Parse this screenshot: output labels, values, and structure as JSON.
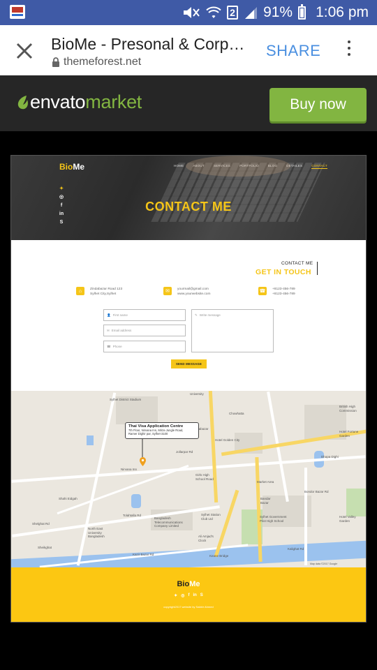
{
  "status_bar": {
    "battery": "91%",
    "time": "1:06 pm",
    "sim_slot": "2"
  },
  "browser": {
    "page_title": "BioMe - Presonal & Corporate",
    "url": "themeforest.net",
    "share_label": "SHARE"
  },
  "envato": {
    "logo_word": "envato",
    "logo_market": "market",
    "buy_label": "Buy now",
    "accent": "#82b541"
  },
  "site": {
    "brand_part1": "Bio",
    "brand_part2": "Me",
    "nav": [
      "HOME",
      "ABOUT",
      "SERVICES",
      "PORTFOLIO",
      "BLOG",
      "DETAILES",
      "CONTACT"
    ],
    "active_nav": "CONTACT",
    "hero_title": "CONTACT ME",
    "accent": "#f5c518"
  },
  "contact": {
    "small_heading": "CONTACT ME",
    "heading": "GET IN TOUCH",
    "address_line1": "Zindabazar Road 123",
    "address_line2": "Sylhet City,Sylhet",
    "email_line1": "yourmail@gmail.com",
    "email_line2": "www.yourwebsite.com",
    "phone_line1": "+8123-456-789",
    "phone_line2": "+8123-456-789",
    "first_name_placeholder": "First name",
    "email_placeholder": "Email address",
    "phone_placeholder": "Phone",
    "message_placeholder": "Write message",
    "send_label": "SEND MESSAGE"
  },
  "map": {
    "tooltip_title": "Thai Visa Application Centre",
    "tooltip_address1": "7th Floor, Nirvana Inn, Mirza Jungle Road,",
    "tooltip_address2": "Ramer Dighir par, Sylhet-3100",
    "labels": {
      "stadium": "Sylhet District Stadium",
      "university": "University",
      "british_high_commission": "British High Commission",
      "hotel_fortune_garden": "Hotel Fortune Garden",
      "hotel_golden_city": "Hotel Golden City",
      "jollarpar": "Jollarpar Rd",
      "nirvana": "Nirvana Inn",
      "girls_high_school": "Girls High School Road",
      "market_area": "Market Area",
      "bandar_bazar": "Bandar Bazar",
      "shahi_eidgah": "Shahi Eidgah",
      "bangladesh_telecom": "Bangladesh Telecommunications Company Limited",
      "sylhet_station_club": "Sylhet Station Club Ltd",
      "north_east_university": "North East University Bangladesh",
      "government_pilot": "Sylhet Government Pilot High School",
      "ali_amjad": "Ali Amjad's Clock",
      "keane_bridge": "Keane Bridge",
      "dhopa_dighi": "Dhopa Dighi",
      "hotel_valley_garden": "Hotel Valley Garden",
      "tolahtalla_rd": "Tolahtalla Rd",
      "zindabazar": "Zindabazar",
      "shelghat": "Shelghat Rd",
      "kazir_bazar": "Kazir Bazar Rd",
      "sheikghat": "Sheikghat",
      "kalighat": "Kalighat Rd",
      "chowhatta": "Chowhatta",
      "bondor_bazar": "Bondor Bazar Rd",
      "map_data": "Map data ©2017 Google"
    }
  },
  "footer": {
    "brand_part1": "Bio",
    "brand_part2": "Me",
    "copyright": "copyright2017 website by Sabbir Ahmed"
  }
}
